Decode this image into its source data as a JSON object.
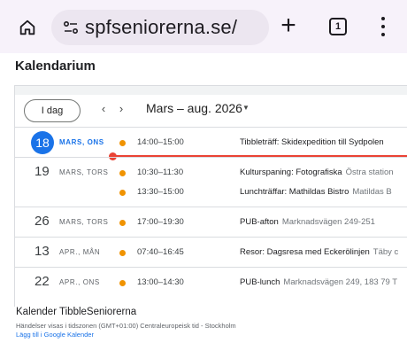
{
  "browser": {
    "url": "spfseniorerna.se/",
    "home_icon": "home-icon",
    "site_settings_icon": "tune-icon",
    "new_tab_icon": "plus-icon",
    "tab_count": "1",
    "menu_icon": "more-vert-icon"
  },
  "page": {
    "title": "Kalendarium"
  },
  "calendar": {
    "today_label": "I dag",
    "prev_icon": "chevron-left-icon",
    "next_icon": "chevron-right-icon",
    "range": "Mars – aug. 2026",
    "range_caret_icon": "caret-down-icon",
    "event_color": "#f09300",
    "today_color": "#1a73e8",
    "now_line_color": "#ea4335",
    "days": [
      {
        "num": "18",
        "label": "MARS, ONS",
        "is_today": true,
        "events": [
          {
            "time": "14:00–15:00",
            "title": "Tibbleträff: Skidexpedition till Sydpolen",
            "location": ""
          }
        ]
      },
      {
        "num": "19",
        "label": "MARS, TORS",
        "is_today": false,
        "events": [
          {
            "time": "10:30–11:30",
            "title": "Kulturspaning: Fotografiska",
            "location": "Östra station"
          },
          {
            "time": "13:30–15:00",
            "title": "Lunchträffar: Mathildas Bistro",
            "location": "Matildas B"
          }
        ]
      },
      {
        "num": "26",
        "label": "MARS, TORS",
        "is_today": false,
        "events": [
          {
            "time": "17:00–19:30",
            "title": "PUB-afton",
            "location": "Marknadsvägen 249-251"
          }
        ]
      },
      {
        "num": "13",
        "label": "APR., MÅN",
        "is_today": false,
        "events": [
          {
            "time": "07:40–16:45",
            "title": "Resor: Dagsresa med Eckerölinjen",
            "location": "Täby c"
          }
        ]
      },
      {
        "num": "22",
        "label": "APR., ONS",
        "is_today": false,
        "events": [
          {
            "time": "13:00–14:30",
            "title": "PUB-lunch",
            "location": "Marknadsvägen 249, 183 79 T"
          }
        ]
      }
    ]
  },
  "footer": {
    "calendar_name": "Kalender TibbleSeniorerna",
    "timezone_note": "Händelser visas i tidszonen (GMT+01:00) Centraleuropeisk tid - Stockholm",
    "add_link": "Lägg till i Google Kalender"
  }
}
